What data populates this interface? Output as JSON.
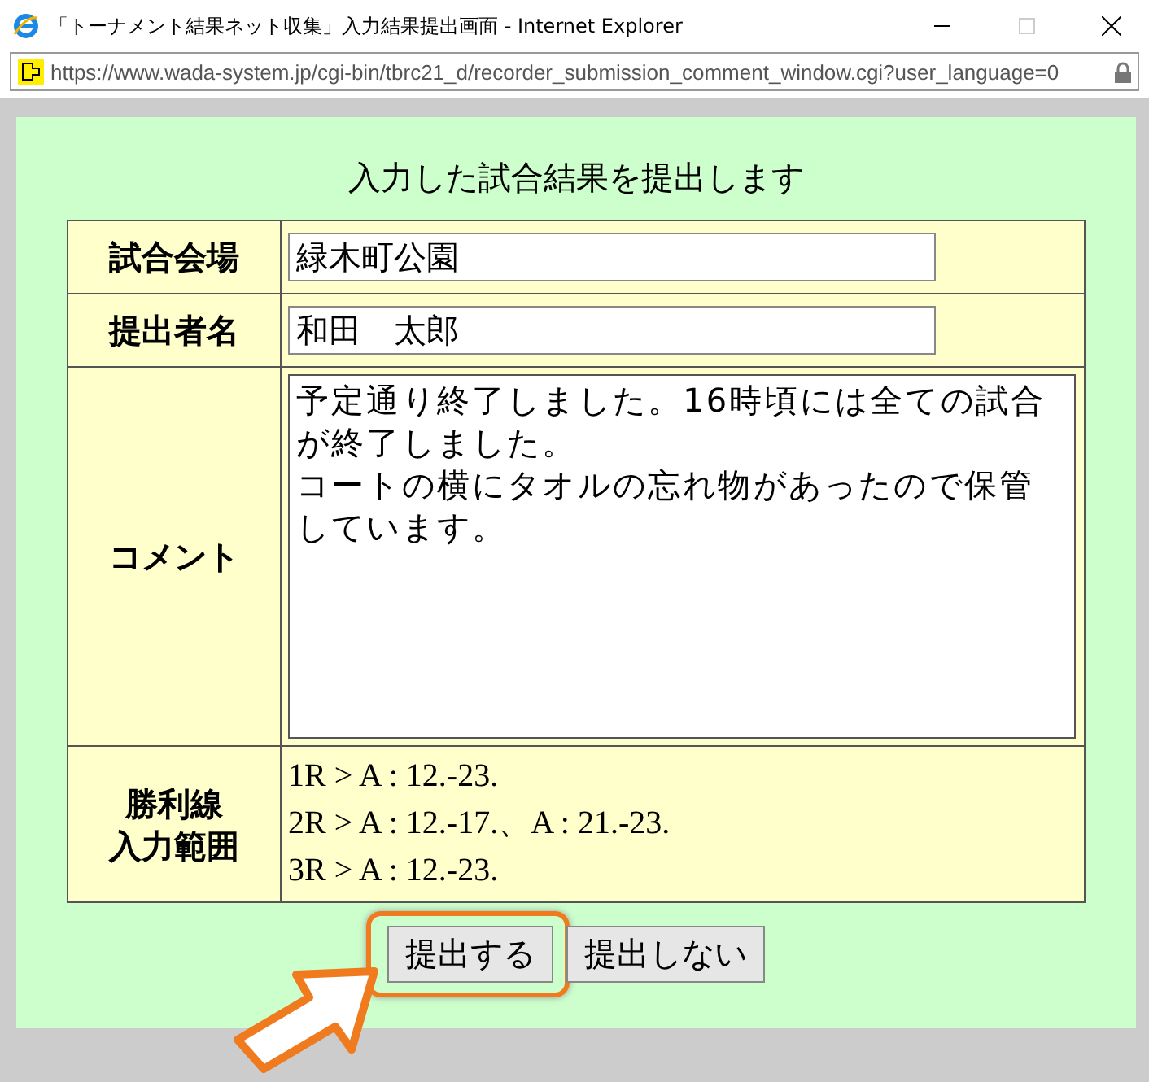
{
  "window": {
    "title": "「トーナメント結果ネット収集」入力結果提出画面 - Internet Explorer",
    "maximize_disabled": true
  },
  "address_bar": {
    "url": "https://www.wada-system.jp/cgi-bin/tbrc21_d/recorder_submission_comment_window.cgi?user_language=0"
  },
  "heading": "入力した試合結果を提出します",
  "form": {
    "rows": [
      {
        "kind": "input",
        "label": "試合会場",
        "value": "緑木町公園"
      },
      {
        "kind": "input",
        "label": "提出者名",
        "value": "和田　太郎"
      },
      {
        "kind": "textarea",
        "label": "コメント",
        "paragraphs": [
          "予定通り終了しました。16時頃には全ての試合が終了しました。",
          "コートの横にタオルの忘れ物があったので保管しています。"
        ]
      },
      {
        "kind": "lines",
        "label_lines": [
          "勝利線",
          "入力範囲"
        ],
        "lines": [
          "1R > A : 12.-23.",
          "2R > A : 12.-17.、A : 21.-23.",
          "3R > A : 12.-23."
        ]
      }
    ]
  },
  "buttons": [
    {
      "label": "提出する",
      "highlighted": true
    },
    {
      "label": "提出しない",
      "highlighted": false
    }
  ]
}
